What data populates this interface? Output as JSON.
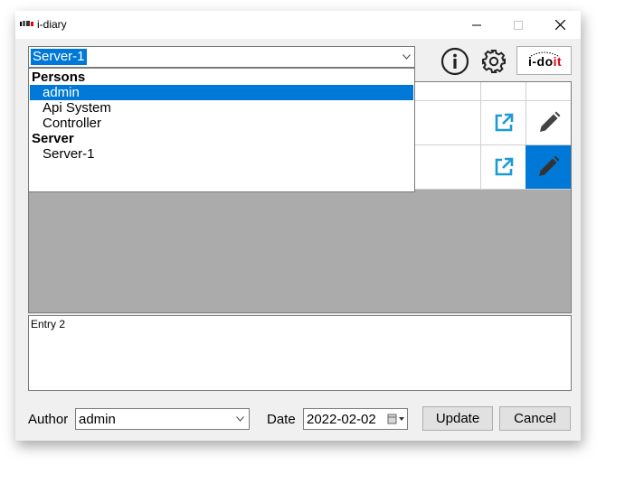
{
  "window": {
    "title": "i-diary",
    "icon": "i-diary-app-icon",
    "controls": [
      "minimize-icon",
      "maximize-icon",
      "close-icon"
    ]
  },
  "toolbar": {
    "selector_value": "Server-1",
    "info_icon": "info-icon",
    "settings_icon": "gear-icon",
    "logo_text_i": "i-do",
    "logo_text_it": "it"
  },
  "dropdown": {
    "groups": [
      {
        "label": "Persons",
        "items": [
          "admin",
          "Api System",
          "Controller"
        ]
      },
      {
        "label": "Server",
        "items": [
          "Server-1"
        ]
      }
    ],
    "selected_item": "admin"
  },
  "grid": {
    "rows": [
      {
        "open_icon": "external-link-icon",
        "edit_icon": "pencil-icon",
        "selected": false
      },
      {
        "open_icon": "external-link-icon",
        "edit_icon": "pencil-icon",
        "selected": true
      }
    ]
  },
  "entry": {
    "text": "Entry 2"
  },
  "footer": {
    "author_label": "Author",
    "author_value": "admin",
    "date_label": "Date",
    "date_value": "2022-02-02",
    "update_label": "Update",
    "cancel_label": "Cancel"
  },
  "colors": {
    "accent": "#0078d7",
    "link_icon": "#1b9ad6",
    "logo_red": "#e30613"
  }
}
